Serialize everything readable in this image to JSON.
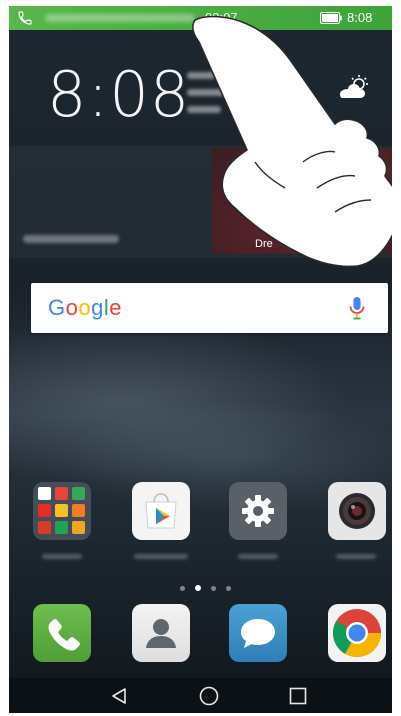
{
  "status_bar": {
    "call_timer": "00:07",
    "clock": "8:08",
    "call_icon": "phone-call-icon",
    "battery_icon": "battery-icon"
  },
  "clock_widget": {
    "time": "8:08",
    "weather_icon": "partly-cloudy-icon"
  },
  "music_widget": {
    "album_title": "Dre"
  },
  "search": {
    "logo": [
      "G",
      "o",
      "o",
      "g",
      "l",
      "e"
    ],
    "logo_colors": [
      "#4285F4",
      "#EA4335",
      "#FBBC05",
      "#4285F4",
      "#34A853",
      "#EA4335"
    ],
    "mic_icon": "microphone-icon"
  },
  "apps": [
    {
      "name": "google-folder",
      "icon": "folder-icon"
    },
    {
      "name": "play-store",
      "icon": "play-store-icon"
    },
    {
      "name": "settings",
      "icon": "gear-icon"
    },
    {
      "name": "camera",
      "icon": "camera-icon"
    }
  ],
  "pager": {
    "pages": 4,
    "active": 1
  },
  "dock": [
    {
      "name": "phone",
      "icon": "phone-icon"
    },
    {
      "name": "contacts",
      "icon": "contacts-icon"
    },
    {
      "name": "messages",
      "icon": "messages-icon"
    },
    {
      "name": "chrome",
      "icon": "chrome-icon"
    }
  ],
  "navigation": {
    "back_icon": "back-triangle-icon",
    "home_icon": "home-circle-icon",
    "recents_icon": "recents-square-icon"
  },
  "colors": {
    "status_bar_green": "#4cae42",
    "phone_green": "#5aa943",
    "messages_blue": "#3a8cc4"
  }
}
